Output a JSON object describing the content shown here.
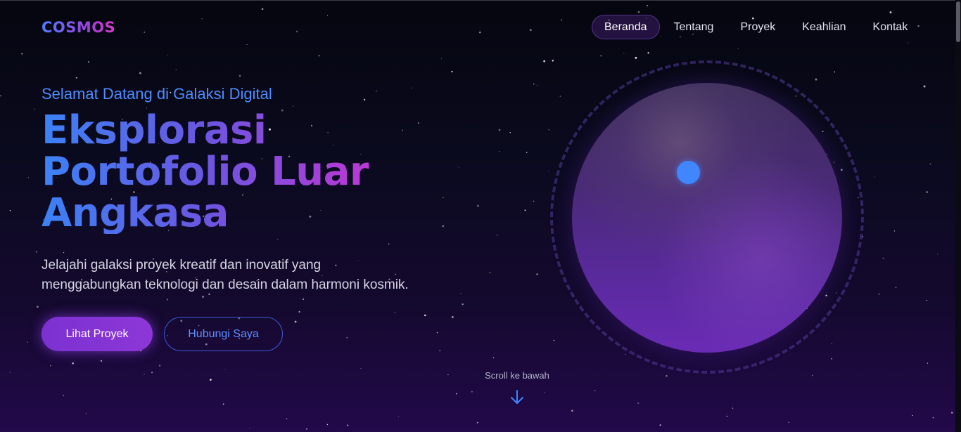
{
  "brand": {
    "logo": "COSMOS"
  },
  "nav": {
    "items": [
      {
        "label": "Beranda",
        "active": true
      },
      {
        "label": "Tentang",
        "active": false
      },
      {
        "label": "Proyek",
        "active": false
      },
      {
        "label": "Keahlian",
        "active": false
      },
      {
        "label": "Kontak",
        "active": false
      }
    ]
  },
  "hero": {
    "subtitle": "Selamat Datang di Galaksi Digital",
    "headline": [
      "Eksplorasi",
      "Portofolio Luar",
      "Angkasa"
    ],
    "description": [
      "Jelajahi galaksi proyek kreatif dan inovatif yang",
      "menggabungkan teknologi dan desain dalam harmoni kosmik."
    ],
    "primary_button": "Lihat Proyek",
    "secondary_button": "Hubungi Saya"
  },
  "scroll": {
    "label": "Scroll ke bawah",
    "icon": "arrow-down-icon"
  },
  "illustration": {
    "planet_icon": "planet-icon",
    "moon_icon": "moon-icon",
    "orbit_icon": "orbit-ring"
  },
  "colors": {
    "accent_blue": "#3f86ff",
    "accent_purple": "#8e36d8",
    "accent_pink": "#d33fc0",
    "background_top": "#05060f",
    "background_bottom": "#22094a"
  }
}
